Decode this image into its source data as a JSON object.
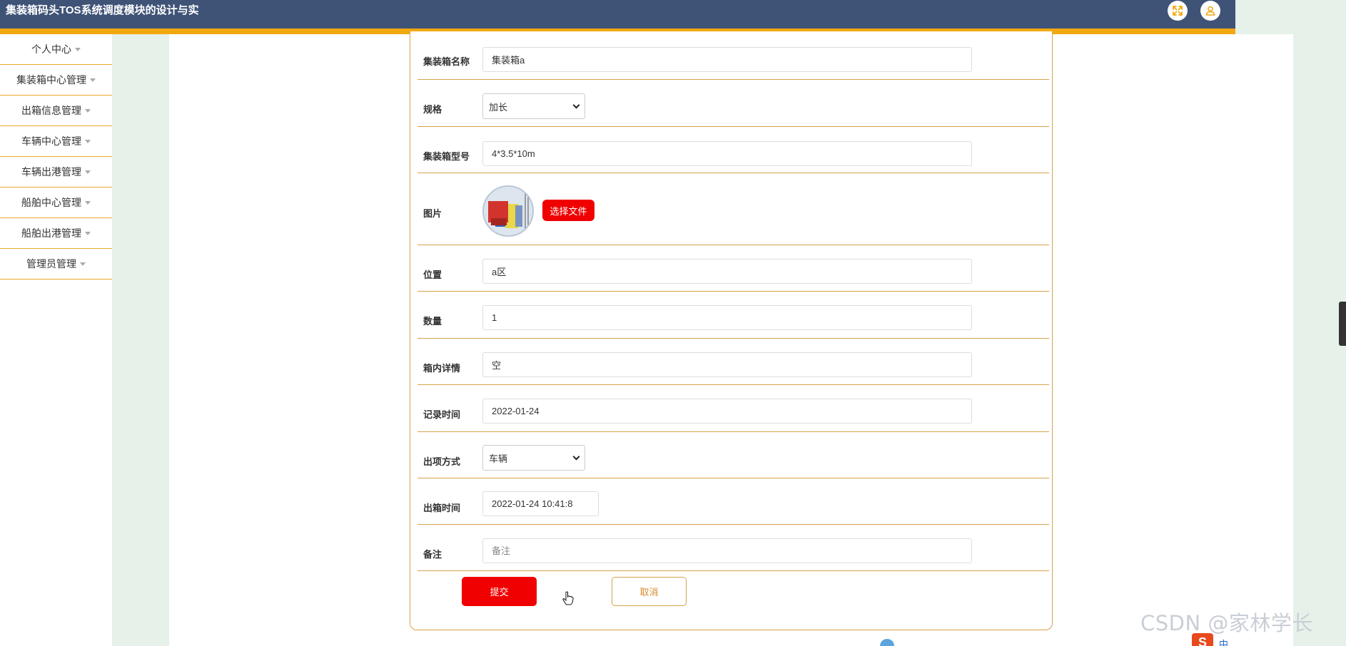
{
  "header": {
    "title": "集装箱码头TOS系统调度模块的设计与实",
    "fullscreen_icon": "expand-arrows-icon",
    "user_icon": "user-icon",
    "colors": {
      "bar": "#3f5377",
      "strip": "#f2a80f",
      "icon_accent": "#f2a80f"
    }
  },
  "sidebar": {
    "items": [
      {
        "label": "个人中心"
      },
      {
        "label": "集装箱中心管理"
      },
      {
        "label": "出箱信息管理"
      },
      {
        "label": "车辆中心管理"
      },
      {
        "label": "车辆出港管理"
      },
      {
        "label": "船舶中心管理"
      },
      {
        "label": "船舶出港管理"
      },
      {
        "label": "管理员管理"
      }
    ]
  },
  "form": {
    "container_name": {
      "label": "集装箱名称",
      "value": "集装箱a"
    },
    "spec": {
      "label": "规格",
      "selected": "加长"
    },
    "model": {
      "label": "集装箱型号",
      "value": "4*3.5*10m"
    },
    "image": {
      "label": "图片",
      "choose_file_label": "选择文件"
    },
    "location": {
      "label": "位置",
      "value": "a区"
    },
    "quantity": {
      "label": "数量",
      "value": "1"
    },
    "details": {
      "label": "箱内详情",
      "value": "空"
    },
    "record_time": {
      "label": "记录时间",
      "value": "2022-01-24"
    },
    "exit_method": {
      "label": "出项方式",
      "selected": "车辆"
    },
    "exit_time": {
      "label": "出箱时间",
      "value": "2022-01-24 10:41:8"
    },
    "remark": {
      "label": "备注",
      "placeholder": "备注"
    },
    "submit_label": "提交",
    "cancel_label": "取消",
    "colors": {
      "submit": "#f00000",
      "border": "#d6a24a",
      "cancel_text": "#d98b2c"
    }
  },
  "watermark": "CSDN @家林学长",
  "taskbar": {
    "badge": "S",
    "ime": "中"
  }
}
